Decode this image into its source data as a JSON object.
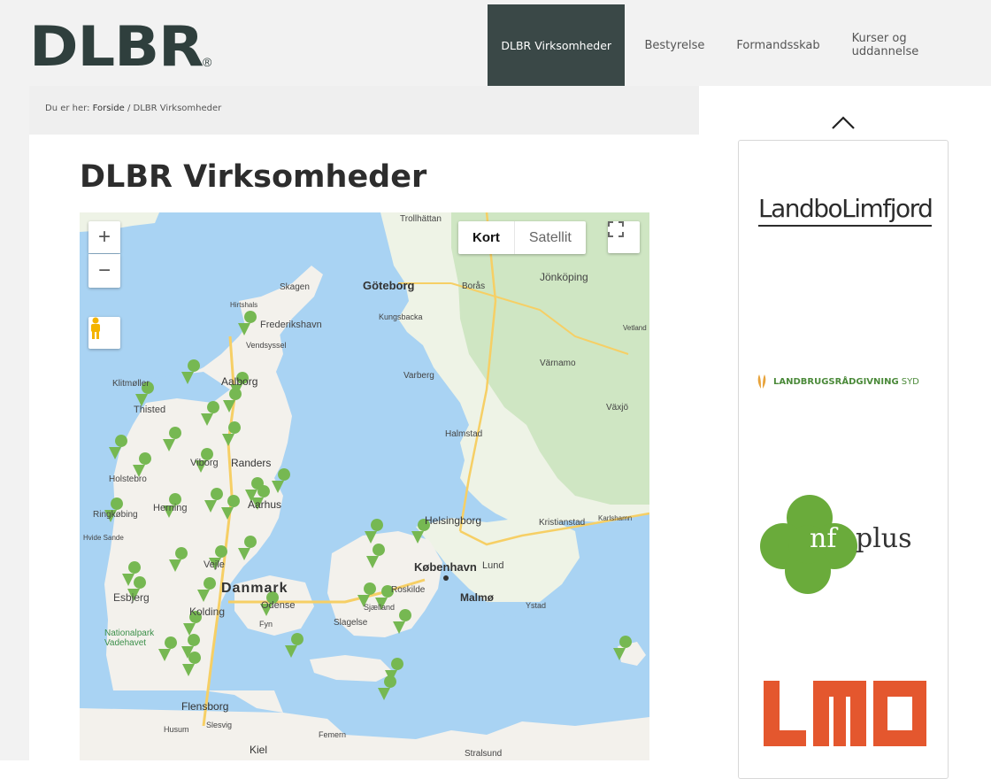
{
  "header": {
    "logo_text": "DLBR",
    "logo_mark": "®",
    "nav": [
      {
        "label": "DLBR Virksomheder",
        "active": true
      },
      {
        "label": "Bestyrelse",
        "active": false
      },
      {
        "label": "Formandsskab",
        "active": false
      },
      {
        "label": "Kurser og uddannelse",
        "active": false
      }
    ]
  },
  "breadcrumb": {
    "prefix": "Du er her:",
    "home": "Forside",
    "separator": "/",
    "current": "DLBR Virksomheder"
  },
  "page": {
    "title": "DLBR Virksomheder"
  },
  "map": {
    "zoom_in": "+",
    "zoom_out": "−",
    "type_map": "Kort",
    "type_satellite": "Satellit",
    "labels": [
      "Trollhättan",
      "Göteborg",
      "Borås",
      "Jönköping",
      "Skagen",
      "Hirtshals",
      "Frederikshavn",
      "Vendsyssel",
      "Kungsbacka",
      "Klitmøller",
      "Aalborg",
      "Thisted",
      "Varberg",
      "Värnamo",
      "Växjö",
      "Halmstad",
      "Viborg",
      "Randers",
      "Holstebro",
      "Aarhus",
      "Herning",
      "Ringkøbing",
      "Hvide Sande",
      "Helsingborg",
      "Kristianstad",
      "Karlshamn",
      "Vejle",
      "København",
      "Lund",
      "Malmø",
      "Esbjerg",
      "Danmark",
      "Roskilde",
      "Kolding",
      "Odense",
      "Sjælland",
      "Ystad",
      "Fyn",
      "Slagelse",
      "Nationalpark Vadehavet",
      "Flensborg",
      "Husum",
      "Slesvig",
      "Femern",
      "Kiel",
      "Stralsund",
      "Vetland"
    ],
    "colors": {
      "water": "#a9d3f3",
      "land": "#f3f1ec",
      "forest": "#cde6c0",
      "road": "#f6cf65",
      "marker": "#76b852"
    }
  },
  "sidebar": {
    "logos": [
      {
        "name": "Landbo Limfjord",
        "text": "LandboLimfjord"
      },
      {
        "name": "Landbrugsrådgivning Syd",
        "text": "LANDBRUGSRÅDGIVNING",
        "suffix": "SYD"
      },
      {
        "name": "nf plus",
        "text_a": "nf",
        "text_b": "plus"
      },
      {
        "name": "LMO",
        "text": "LMO"
      }
    ]
  }
}
